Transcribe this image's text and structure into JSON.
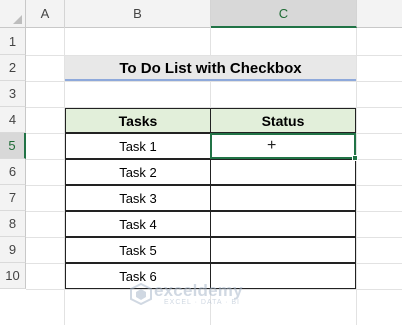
{
  "column_headers": [
    "A",
    "B",
    "C"
  ],
  "row_headers": [
    "1",
    "2",
    "3",
    "4",
    "5",
    "6",
    "7",
    "8",
    "9",
    "10"
  ],
  "selected_column": "C",
  "selected_row": "5",
  "title": "To Do List with Checkbox",
  "table": {
    "headers": [
      "Tasks",
      "Status"
    ],
    "rows": [
      {
        "task": "Task 1",
        "status": ""
      },
      {
        "task": "Task 2",
        "status": ""
      },
      {
        "task": "Task 3",
        "status": ""
      },
      {
        "task": "Task 4",
        "status": ""
      },
      {
        "task": "Task 5",
        "status": ""
      },
      {
        "task": "Task 6",
        "status": ""
      }
    ]
  },
  "cursor_glyph": "+",
  "watermark": {
    "name": "exceldemy",
    "tagline": "EXCEL · DATA · BI"
  },
  "colors": {
    "header_fill": "#e2efda",
    "selection": "#217346",
    "title_underline": "#8ea9db"
  }
}
